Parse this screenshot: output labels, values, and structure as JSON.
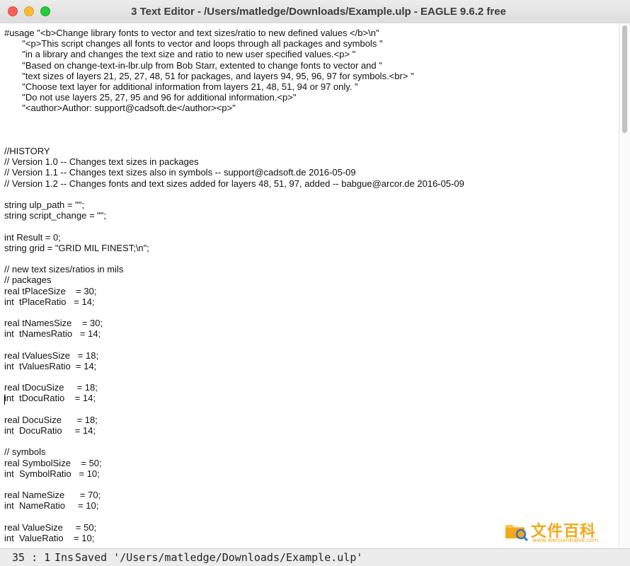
{
  "window": {
    "title": "3 Text Editor - /Users/matledge/Downloads/Example.ulp - EAGLE 9.6.2 free"
  },
  "editor": {
    "lines": [
      "#usage \"<b>Change library fonts to vector and text sizes/ratio to new defined values </b>\\n\"",
      "       \"<p>This script changes all fonts to vector and loops through all packages and symbols \"",
      "       \"in a library and changes the text size and ratio to new user specified values.<p> \"",
      "       \"Based on change-text-in-lbr.ulp from Bob Starr, extented to change fonts to vector and \"",
      "       \"text sizes of layers 21, 25, 27, 48, 51 for packages, and layers 94, 95, 96, 97 for symbols.<br> \"",
      "       \"Choose text layer for additional information from layers 21, 48, 51, 94 or 97 only. \"",
      "       \"Do not use layers 25, 27, 95 and 96 for additional information.<p>\"",
      "       \"<author>Author: support@cadsoft.de</author><p>\"",
      "",
      "",
      "",
      "//HISTORY",
      "// Version 1.0 -- Changes text sizes in packages",
      "// Version 1.1 -- Changes text sizes also in symbols -- support@cadsoft.de 2016-05-09",
      "// Version 1.2 -- Changes fonts and text sizes added for layers 48, 51, 97, added -- babgue@arcor.de 2016-05-09",
      "",
      "string ulp_path = \"\";",
      "string script_change = \"\";",
      "",
      "int Result = 0;",
      "string grid = \"GRID MIL FINEST;\\n\";",
      "",
      "// new text sizes/ratios in mils",
      "// packages",
      "real tPlaceSize    = 30;",
      "int  tPlaceRatio   = 14;",
      "",
      "real tNamesSize    = 30;",
      "int  tNamesRatio   = 14;",
      "",
      "real tValuesSize   = 18;",
      "int  tValuesRatio  = 14;",
      "",
      "real tDocuSize     = 18;",
      "int  tDocuRatio    = 14;",
      "",
      "real DocuSize      = 18;",
      "int  DocuRatio     = 14;",
      "",
      "// symbols",
      "real SymbolSize    = 50;",
      "int  SymbolRatio   = 10;",
      "",
      "real NameSize      = 70;",
      "int  NameRatio     = 10;",
      "",
      "real ValueSize     = 50;",
      "int  ValueRatio    = 10;"
    ]
  },
  "status": {
    "position": "35 : 1",
    "mode": "Ins",
    "message": "Saved '/Users/matledge/Downloads/Example.ulp'"
  },
  "watermark": {
    "text": "文件百科",
    "sub": "www.wenjianbaike.com"
  },
  "colors": {
    "close": "#fe5f57",
    "minimize": "#febc2e",
    "maximize": "#28c840",
    "watermark": "#f2a81d"
  }
}
